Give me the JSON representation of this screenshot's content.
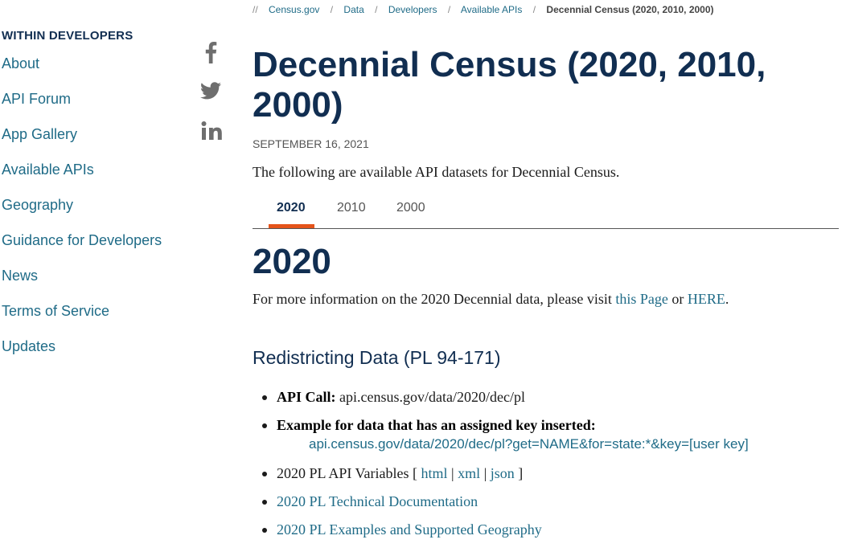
{
  "breadcrumb": {
    "lead": "//",
    "items": [
      "Census.gov",
      "Data",
      "Developers",
      "Available APIs"
    ],
    "current": "Decennial Census (2020, 2010, 2000)"
  },
  "sidebar": {
    "title": "WITHIN DEVELOPERS",
    "items": [
      "About",
      "API Forum",
      "App Gallery",
      "Available APIs",
      "Geography",
      "Guidance for Developers",
      "News",
      "Terms of Service",
      "Updates"
    ]
  },
  "social": [
    "facebook-icon",
    "twitter-icon",
    "linkedin-icon"
  ],
  "page": {
    "title": "Decennial Census (2020, 2010, 2000)",
    "date": "SEPTEMBER 16, 2021",
    "intro": "The following are available API datasets for Decennial Census."
  },
  "tabs": [
    {
      "label": "2020",
      "active": true
    },
    {
      "label": "2010",
      "active": false
    },
    {
      "label": "2000",
      "active": false
    }
  ],
  "section": {
    "heading": "2020",
    "more_info_prefix": "For more information on the 2020 Decennial data, please visit ",
    "link1": "this Page",
    "or_text": " or ",
    "link2": "HERE",
    "suffix": ".",
    "subheading": "Redistricting Data (PL 94-171)"
  },
  "bullets": {
    "api_call_label": "API Call:",
    "api_call_value": " api.census.gov/data/2020/dec/pl",
    "example_label": "Example for data that has an assigned key inserted:",
    "example_url": "api.census.gov/data/2020/dec/pl?get=NAME&for=state:*&key=[user key]",
    "variables_prefix": "2020 PL API Variables [ ",
    "var_html": "html",
    "pipe": " | ",
    "var_xml": "xml",
    "var_json": "json",
    "variables_suffix": " ]",
    "tech_doc": "2020 PL Technical Documentation",
    "examples_geo": "2020 PL Examples and Supported Geography"
  },
  "colors": {
    "navy": "#112e51",
    "link": "#1f6b87",
    "accent": "#e5541b",
    "icon": "#6e6e6e"
  }
}
